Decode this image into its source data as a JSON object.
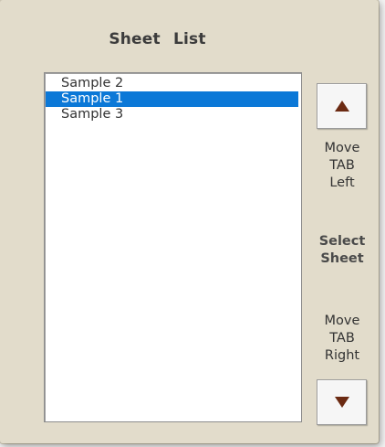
{
  "dialog": {
    "title": "Sheet  List"
  },
  "sheet_list": {
    "items": [
      {
        "label": "Sample 2",
        "selected": false
      },
      {
        "label": "Sample 1",
        "selected": true
      },
      {
        "label": "Sample 3",
        "selected": false
      }
    ],
    "selected_color": "#0b78d7"
  },
  "controls": {
    "move_left": {
      "icon": "triangle-up-icon",
      "lines": [
        "Move",
        "TAB",
        "Left"
      ]
    },
    "select_sheet": {
      "lines": [
        "Select",
        "Sheet"
      ]
    },
    "move_right": {
      "icon": "triangle-down-icon",
      "lines": [
        "Move",
        "TAB",
        "Right"
      ]
    },
    "arrow_color": "#6b2a12"
  }
}
